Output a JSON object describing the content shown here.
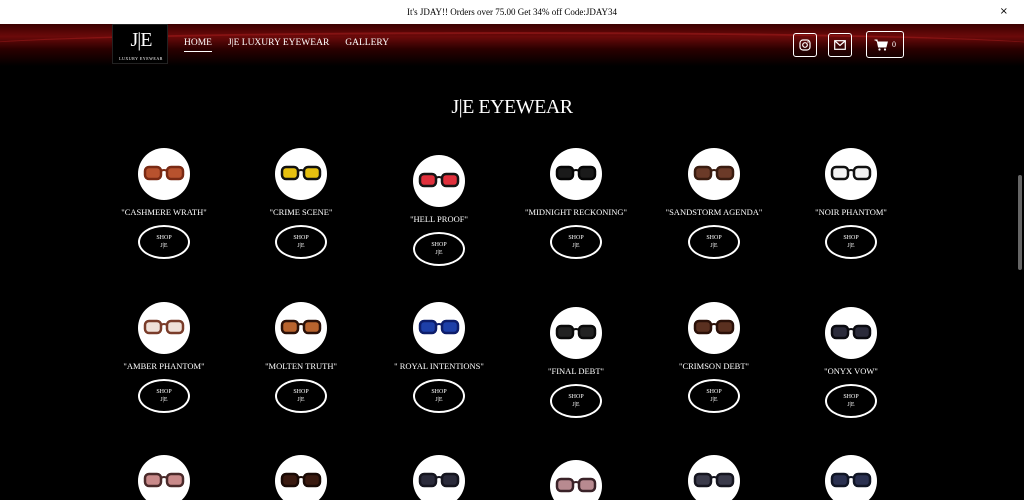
{
  "announcement": {
    "text": "It's JDAY!! Orders over 75.00 Get 34% off Code:JDAY34",
    "close": "×"
  },
  "logo": {
    "mark": "J|E",
    "subtitle": "LUXURY EYEWEAR"
  },
  "nav": {
    "items": [
      "HOME",
      "J|E LUXURY EYEWEAR",
      "GALLERY"
    ]
  },
  "cart": {
    "count": "0"
  },
  "brand_title": "J|E EYEWEAR",
  "products": [
    {
      "name": "\"CASHMERE WRATH\"",
      "shop": "SHOP J|E",
      "lens": "#b8522e",
      "frame": "#7a2a14"
    },
    {
      "name": "\"CRIME SCENE\"",
      "shop": "SHOP J|E",
      "lens": "#e6c010",
      "frame": "#111111"
    },
    {
      "name": "\"HELL PROOF\"",
      "shop": "SHOP J|E",
      "lens": "#e0303c",
      "frame": "#151515"
    },
    {
      "name": "\"MIDNIGHT RECKONING\"",
      "shop": "SHOP J|E",
      "lens": "#1a1a1a",
      "frame": "#050505"
    },
    {
      "name": "\"SANDSTORM AGENDA\"",
      "shop": "SHOP J|E",
      "lens": "#6b3a28",
      "frame": "#3a1c10"
    },
    {
      "name": "\"NOIR PHANTOM\"",
      "shop": "SHOP J|E",
      "lens": "#f2f2f2",
      "frame": "#101010"
    },
    {
      "name": "\"AMBER PHANTOM\"",
      "shop": "SHOP J|E",
      "lens": "#efe0d8",
      "frame": "#7a3c2a"
    },
    {
      "name": "\"MOLTEN TRUTH\"",
      "shop": "SHOP J|E",
      "lens": "#b8632e",
      "frame": "#2a1008"
    },
    {
      "name": "\" ROYAL INTENTIONS\"",
      "shop": "SHOP J|E",
      "lens": "#1d3fa8",
      "frame": "#0d1d6a"
    },
    {
      "name": "\"FINAL DEBT\"",
      "shop": "SHOP J|E",
      "lens": "#222222",
      "frame": "#0a0a0a"
    },
    {
      "name": "\"CRIMSON DEBT\"",
      "shop": "SHOP J|E",
      "lens": "#5a3020",
      "frame": "#2a1008"
    },
    {
      "name": "\"ONYX VOW\"",
      "shop": "SHOP J|E",
      "lens": "#2a2a3a",
      "frame": "#0a0a10"
    },
    {
      "name": "",
      "shop": "",
      "lens": "#c98a8a",
      "frame": "#4a2a2a"
    },
    {
      "name": "",
      "shop": "",
      "lens": "#3a1a10",
      "frame": "#1a0a05"
    },
    {
      "name": "",
      "shop": "",
      "lens": "#2a2a3a",
      "frame": "#15151f"
    },
    {
      "name": "",
      "shop": "",
      "lens": "#b88a90",
      "frame": "#3a2228"
    },
    {
      "name": "",
      "shop": "",
      "lens": "#3a3a4a",
      "frame": "#15151f"
    },
    {
      "name": "",
      "shop": "",
      "lens": "#2a3050",
      "frame": "#101525"
    }
  ],
  "icons": {
    "instagram": "instagram-icon",
    "email": "email-icon",
    "cart": "cart-icon"
  }
}
